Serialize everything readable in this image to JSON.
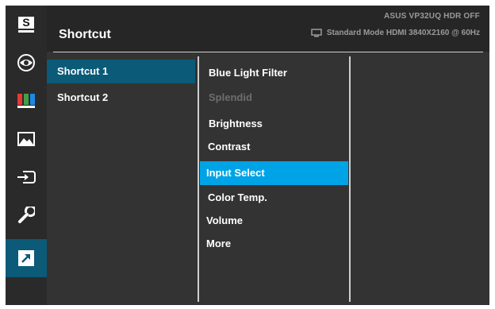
{
  "header": {
    "title": "Shortcut",
    "model_info": "ASUS  VP32UQ  HDR OFF",
    "mode_info": "Standard Mode HDMI 3840X2160 @ 60Hz"
  },
  "sidebar": {
    "items": [
      {
        "name": "splendid",
        "icon": "splendid-icon",
        "label": "S"
      },
      {
        "name": "blue-light-filter",
        "icon": "eye-icon"
      },
      {
        "name": "color",
        "icon": "color-bars-icon"
      },
      {
        "name": "image",
        "icon": "image-icon"
      },
      {
        "name": "input-select",
        "icon": "input-icon"
      },
      {
        "name": "system-setup",
        "icon": "wrench-icon"
      },
      {
        "name": "shortcut",
        "icon": "shortcut-arrow-icon",
        "active": true
      }
    ]
  },
  "shortcuts": [
    {
      "label": "Shortcut 1",
      "selected": true
    },
    {
      "label": "Shortcut 2",
      "selected": false
    }
  ],
  "options": [
    {
      "label": "Blue Light Filter",
      "state": "normal"
    },
    {
      "label": "Splendid",
      "state": "disabled"
    },
    {
      "label": "Brightness",
      "state": "normal"
    },
    {
      "label": "Contrast",
      "state": "normal"
    },
    {
      "label": "Input Select",
      "state": "selected"
    },
    {
      "label": "Color Temp.",
      "state": "normal"
    },
    {
      "label": "Volume",
      "state": "normal"
    },
    {
      "label": "More",
      "state": "normal"
    }
  ],
  "colors": {
    "accent_selected": "#00a3e6",
    "accent_active": "#0b5a78",
    "background": "#333333"
  }
}
